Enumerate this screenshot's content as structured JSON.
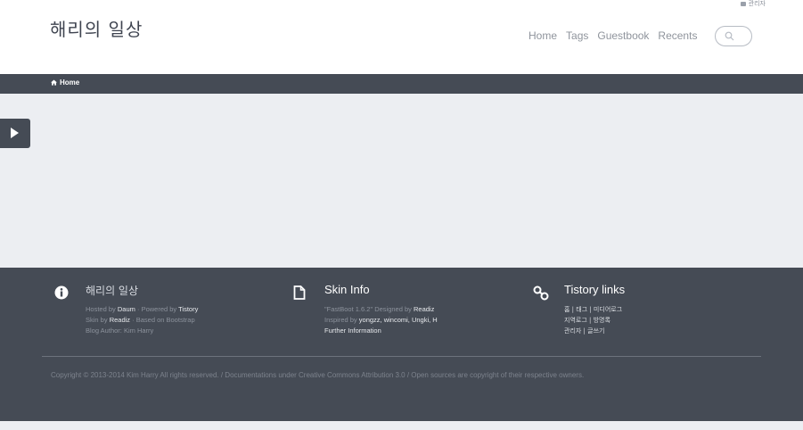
{
  "header": {
    "site_title": "해리의 일상",
    "admin_label": "관리자",
    "nav": [
      "Home",
      "Tags",
      "Guestbook",
      "Recents"
    ]
  },
  "breadcrumb": {
    "label": "Home"
  },
  "footer": {
    "blog": {
      "title": "해리의 일상",
      "hosted_prefix": "Hosted by",
      "hosted_by": "Daum",
      "powered_prefix": "· Powered by",
      "powered_by": "Tistory",
      "skin_prefix": "Skin by",
      "skin_by": "Readiz",
      "skin_suffix": "· Based on Bootstrap",
      "author": "Blog Author: Kim Harry"
    },
    "skin_info": {
      "title": "Skin Info",
      "line1_prefix": "\"FastBoot 1.6.2\" Designed by",
      "line1_designer": "Readiz",
      "line2_prefix": "Inspired by",
      "line2_names": "yongzz, wincomi, Ungki, H",
      "line3": "Further Information"
    },
    "tistory_links": {
      "title": "Tistory links",
      "line1": "홈 | 태그 | 미디어로그",
      "line2": "지역로그 | 방명록",
      "line3": "관리자 | 글쓰기"
    },
    "copyright": "Copyright © 2013-2014 Kim Harry All rights reserved. / Documentations under Creative Commons Attribution 3.0 / Open sources are copyright of their respective owners."
  }
}
